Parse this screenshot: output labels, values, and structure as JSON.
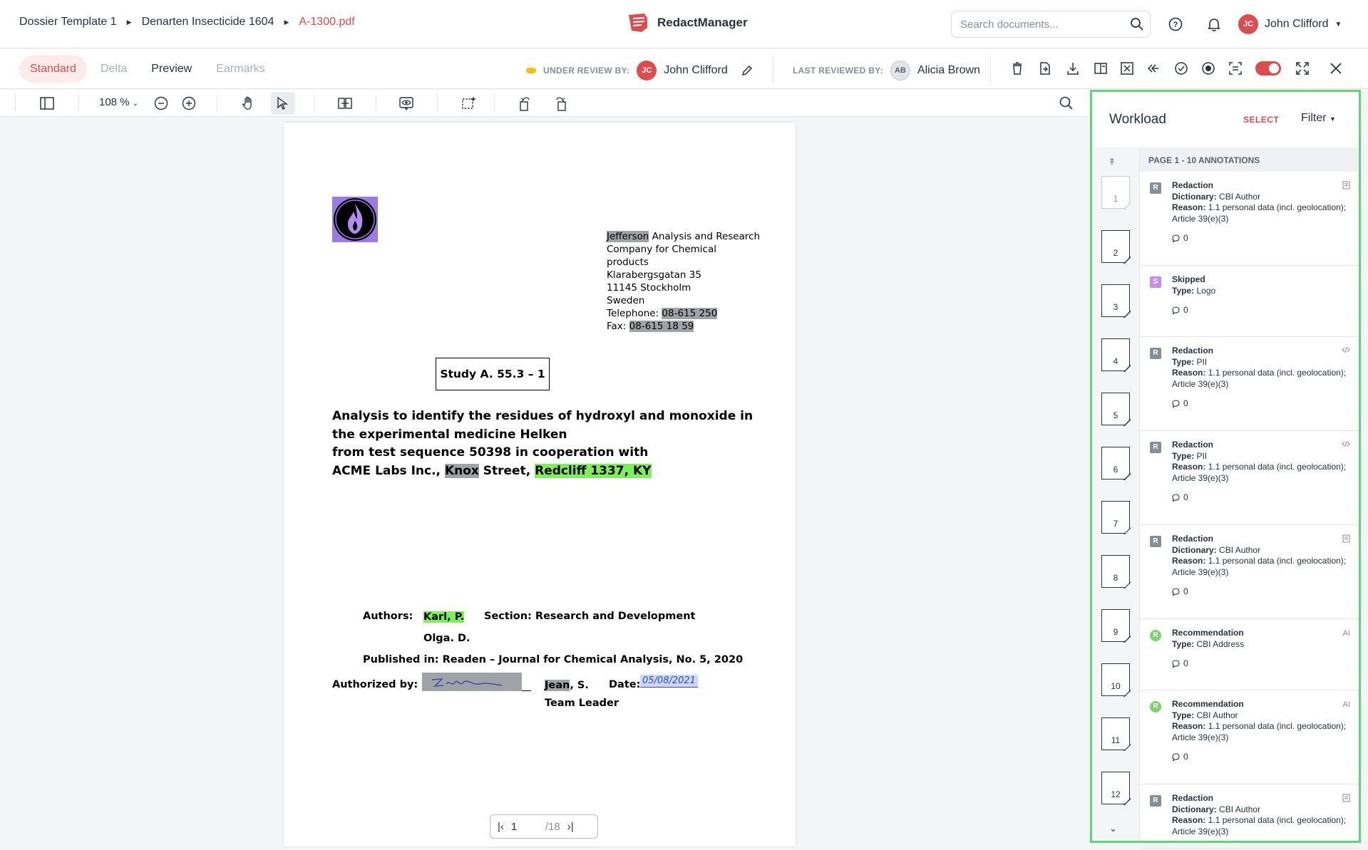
{
  "breadcrumb": {
    "items": [
      "Dossier Template 1",
      "Denarten Insecticide 1604"
    ],
    "current": "A-1300.pdf"
  },
  "app": {
    "name": "RedactManager",
    "brand_color": "#dd4d50"
  },
  "search": {
    "placeholder": "Search documents..."
  },
  "user": {
    "initials": "JC",
    "name": "John Clifford"
  },
  "modes": {
    "standard": "Standard",
    "delta": "Delta",
    "preview": "Preview",
    "earmarks": "Earmarks"
  },
  "review": {
    "under_review_label": "UNDER REVIEW BY:",
    "under_review_initials": "JC",
    "under_review_name": "John Clifford",
    "last_reviewed_label": "LAST REVIEWED BY:",
    "last_reviewed_initials": "AB",
    "last_reviewed_name": "Alicia Brown",
    "status_color": "#fdbd00"
  },
  "toolbar": {
    "zoom": "108 %"
  },
  "document": {
    "address_highlighted": "Jefferson",
    "address_line1_rest": " Analysis and Research",
    "address_line2": "Company for Chemical",
    "address_line3": "products",
    "address_line4": "Klarabergsgatan 35",
    "address_line5": "11145 Stockholm",
    "address_line6": "Sweden",
    "telephone_label": "Telephone: ",
    "telephone": "08-615 250",
    "fax_label": "Fax: ",
    "fax": "08-615 18 59",
    "study": "Study A. 55.3 – 1",
    "title_line1": "Analysis to identify the residues of hydroxyl and monoxide in",
    "title_line2": "the experimental medicine Helken",
    "title_line3": "from test sequence 50398 in cooperation with",
    "title_line4_a": "ACME Labs Inc., ",
    "title_line4_knox": "Knox",
    "title_line4_b": " Street, ",
    "title_line4_city": "Redcliff 1337, KY",
    "authors_label": "Authors:",
    "author1": "Karl, P.",
    "section": "Section: Research and Development",
    "author2": "Olga. D.",
    "published": "Published in: Readen – Journal for Chemical Analysis, No. 5, 2020",
    "authorized_label": "Authorized by:",
    "signer_name": "Jean",
    "signer_rest": ", S.",
    "date_label": "Date:",
    "date_value": "05/08/2021",
    "signer_role": "Team Leader"
  },
  "pager": {
    "current": "1",
    "total": "/18"
  },
  "workload": {
    "title": "Workload",
    "select": "SELECT",
    "filter": "Filter",
    "page_header": "PAGE 1 - 10 ANNOTATIONS",
    "thumbnails": [
      "1",
      "2",
      "3",
      "4",
      "5",
      "6",
      "7",
      "8",
      "9",
      "10",
      "11",
      "12"
    ],
    "annotations": [
      {
        "badge": "R",
        "kind": "redaction",
        "title": "Redaction",
        "key": "Dictionary:",
        "value": "CBI Author",
        "reason": "1.1 personal data (incl. geolocation); Article 39(e)(3)",
        "comments": "0",
        "right": "dict-icon"
      },
      {
        "badge": "S",
        "kind": "skipped",
        "title": "Skipped",
        "key": "Type:",
        "value": "Logo",
        "reason": "",
        "comments": "0",
        "right": ""
      },
      {
        "badge": "R",
        "kind": "redaction",
        "title": "Redaction",
        "key": "Type:",
        "value": "PII",
        "reason": "1.1 personal data (incl. geolocation); Article 39(e)(3)",
        "comments": "0",
        "right": "code-icon"
      },
      {
        "badge": "R",
        "kind": "redaction",
        "title": "Redaction",
        "key": "Type:",
        "value": "PII",
        "reason": "1.1 personal data (incl. geolocation); Article 39(e)(3)",
        "comments": "0",
        "right": "code-icon"
      },
      {
        "badge": "R",
        "kind": "redaction",
        "title": "Redaction",
        "key": "Dictionary:",
        "value": "CBI Author",
        "reason": "1.1 personal data (incl. geolocation); Article 39(e)(3)",
        "comments": "0",
        "right": "dict-icon"
      },
      {
        "badge": "R",
        "kind": "recommendation",
        "title": "Recommendation",
        "key": "Type:",
        "value": "CBI Address",
        "reason": "",
        "comments": "0",
        "right": "AI"
      },
      {
        "badge": "R",
        "kind": "recommendation",
        "title": "Recommendation",
        "key": "Type:",
        "value": "CBI Author",
        "reason": "1.1 personal data (incl. geolocation); Article 39(e)(3)",
        "comments": "0",
        "right": "AI"
      },
      {
        "badge": "R",
        "kind": "redaction",
        "title": "Redaction",
        "key": "Dictionary:",
        "value": "CBI Author",
        "reason": "1.1 personal data (incl. geolocation); Article 39(e)(3)",
        "comments": "",
        "right": "dict-icon"
      }
    ],
    "reason_label": "Reason:",
    "badge_colors": {
      "redaction": "#868e9a",
      "skipped": "#c78df0",
      "recommendation": "#7cd46a"
    }
  }
}
